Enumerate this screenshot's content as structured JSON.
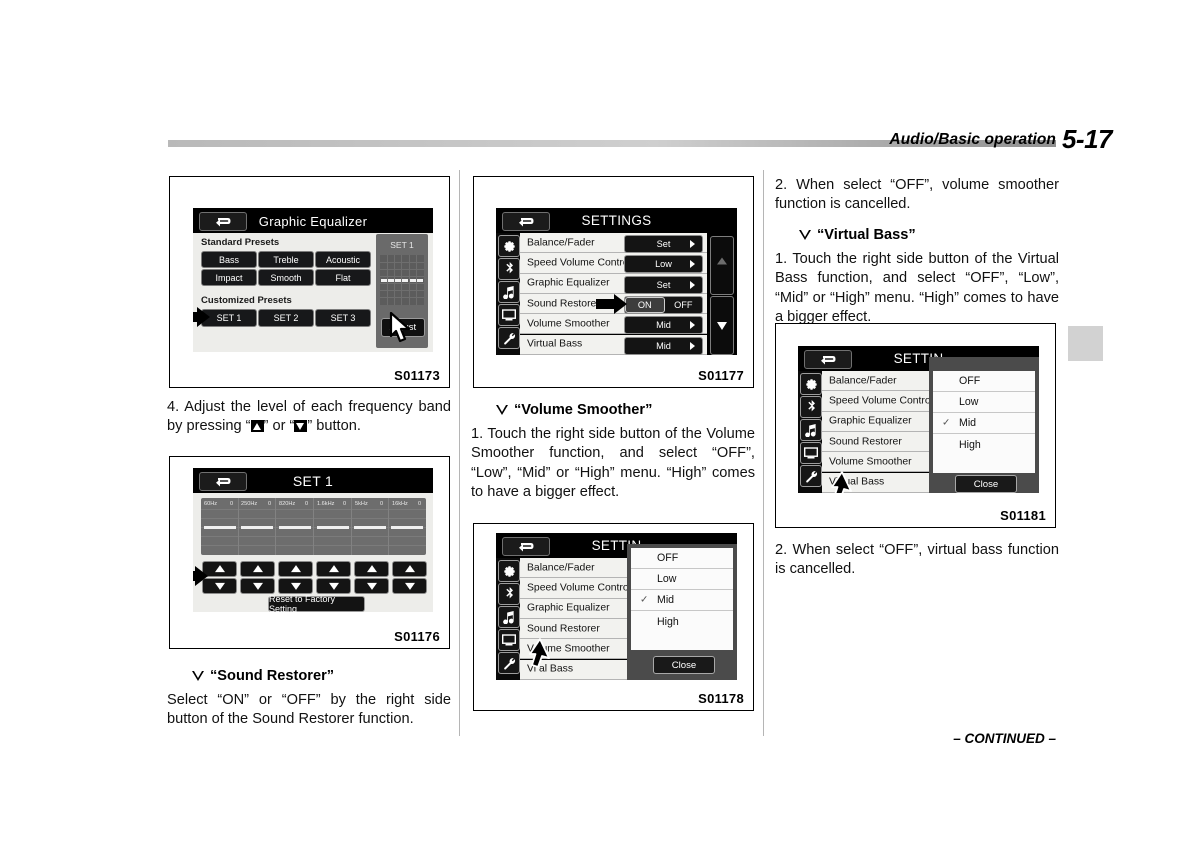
{
  "header": {
    "section_title": "Audio/Basic operation",
    "page_number": "5-17"
  },
  "footer": {
    "continued": "– CONTINUED –"
  },
  "columns": {
    "left": {
      "figure_1": {
        "code": "S01173",
        "screen_title": "Graphic Equalizer",
        "back_icon": "back-arrow-icon",
        "standard_presets_label": "Standard Presets",
        "standard_presets": [
          "Bass",
          "Treble",
          "Acoustic",
          "Impact",
          "Smooth",
          "Flat"
        ],
        "customized_presets_label": "Customized Presets",
        "customized_presets": [
          "SET 1",
          "SET 2",
          "SET 3"
        ],
        "preview_title": "SET 1",
        "adjust_label": "Adjust"
      },
      "step_4": "4. Adjust the level of each frequency band by pressing “",
      "step_4_mid": "” or “",
      "step_4_end": "” button.",
      "figure_2": {
        "code": "S01176",
        "screen_title": "SET 1",
        "back_icon": "back-arrow-icon",
        "bands": [
          {
            "freq": "60Hz",
            "value": "0"
          },
          {
            "freq": "250Hz",
            "value": "0"
          },
          {
            "freq": "820Hz",
            "value": "0"
          },
          {
            "freq": "1.6kHz",
            "value": "0"
          },
          {
            "freq": "5kHz",
            "value": "0"
          },
          {
            "freq": "16kHz",
            "value": "0"
          }
        ],
        "reset_label": "Reset to Factory Setting"
      },
      "sound_restorer_heading": "“Sound Restorer”",
      "sound_restorer_body": "Select “ON” or “OFF” by the right side button of the Sound Restorer function."
    },
    "middle": {
      "figure_3": {
        "code": "S01177",
        "screen_title": "SETTINGS",
        "back_icon": "back-arrow-icon",
        "sidebar_icons": [
          "gear-icon",
          "bluetooth-icon",
          "music-note-icon",
          "display-icon",
          "wrench-icon"
        ],
        "rows": [
          {
            "label": "Balance/Fader",
            "value": "Set",
            "type": "value"
          },
          {
            "label": "Speed Volume Control",
            "value": "Low",
            "type": "value"
          },
          {
            "label": "Graphic Equalizer",
            "value": "Set",
            "type": "value"
          },
          {
            "label": "Sound Restorer",
            "value": "ON",
            "type": "onoff",
            "on_label": "ON",
            "off_label": "OFF",
            "selected": "ON"
          },
          {
            "label": "Volume Smoother",
            "value": "Mid",
            "type": "value"
          },
          {
            "label": "Virtual Bass",
            "value": "Mid",
            "type": "value"
          }
        ]
      },
      "volume_smoother_heading": "“Volume Smoother”",
      "volume_smoother_body": "1. Touch the right side button of the Volume Smoother function, and select “OFF”, “Low”, “Mid” or “High” menu. “High” comes to have a bigger effect.",
      "figure_4": {
        "code": "S01178",
        "screen_title": "SETTIN",
        "back_icon": "back-arrow-icon",
        "sidebar_icons": [
          "gear-icon",
          "bluetooth-icon",
          "music-note-icon",
          "display-icon",
          "wrench-icon"
        ],
        "rows": [
          {
            "label": "Balance/Fader"
          },
          {
            "label": "Speed Volume Control"
          },
          {
            "label": "Graphic Equalizer"
          },
          {
            "label": "Sound Restorer"
          },
          {
            "label": "Volume Smoother"
          },
          {
            "label": "Vi     al Bass"
          }
        ],
        "popup_options": [
          "OFF",
          "Low",
          "Mid",
          "High"
        ],
        "popup_selected": "Mid",
        "close_label": "Close"
      }
    },
    "right": {
      "step_2_volume": "2. When select “OFF”, volume smoother function is cancelled.",
      "virtual_bass_heading": "“Virtual Bass”",
      "virtual_bass_body": "1. Touch the right side button of the Virtual Bass function, and select “OFF”, “Low”, “Mid” or “High” menu. “High” comes to have a bigger effect.",
      "figure_5": {
        "code": "S01181",
        "screen_title": "SETTIN",
        "back_icon": "back-arrow-icon",
        "sidebar_icons": [
          "gear-icon",
          "bluetooth-icon",
          "music-note-icon",
          "display-icon",
          "wrench-icon"
        ],
        "rows": [
          {
            "label": "Balance/Fader"
          },
          {
            "label": "Speed Volume Control"
          },
          {
            "label": "Graphic Equalizer"
          },
          {
            "label": "Sound Restorer"
          },
          {
            "label": "Volume Smoother"
          },
          {
            "label": "Virtual Bass"
          }
        ],
        "popup_options": [
          "OFF",
          "Low",
          "Mid",
          "High"
        ],
        "popup_selected": "Mid",
        "close_label": "Close"
      },
      "step_2_bass": "2. When select “OFF”, virtual bass function is cancelled."
    }
  }
}
